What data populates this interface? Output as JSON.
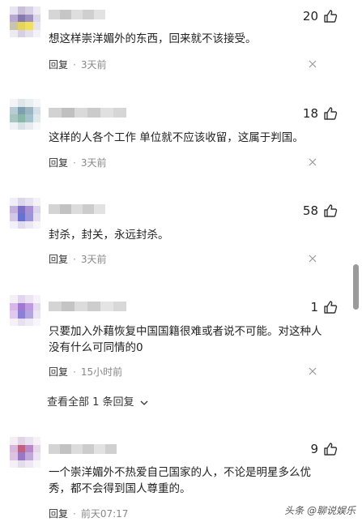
{
  "comments": [
    {
      "likes": "20",
      "text": "想这样崇洋媚外的东西，回来就不该接受。",
      "reply": "回复",
      "time": "3天前"
    },
    {
      "likes": "18",
      "text": "这样的人各个工作 单位就不应该收留，这属于判国。",
      "reply": "回复",
      "time": "3天前"
    },
    {
      "likes": "58",
      "text": "封杀，封关，永远封杀。",
      "reply": "回复",
      "time": "3天前"
    },
    {
      "likes": "1",
      "text": "只要加入外藉恢复中国国籍很难或者说不可能。对这种人没有什么可同情的0",
      "reply": "回复",
      "time": "15小时前",
      "view_all": "查看全部 1 条回复"
    },
    {
      "likes": "9",
      "text": "一个崇洋媚外不热爱自己国家的人，不论是明星多么优秀，都不会得到国人尊重的。",
      "reply": "回复",
      "time": "前天07:17"
    }
  ],
  "watermark": "头条 @聊说娱乐",
  "colors": {
    "text": "#222222",
    "meta": "#888888",
    "scrollbar": "#9a9a9a"
  },
  "icons": [
    "avatar-pixelated",
    "thumbs-up-icon",
    "close-icon",
    "chevron-down-icon"
  ]
}
